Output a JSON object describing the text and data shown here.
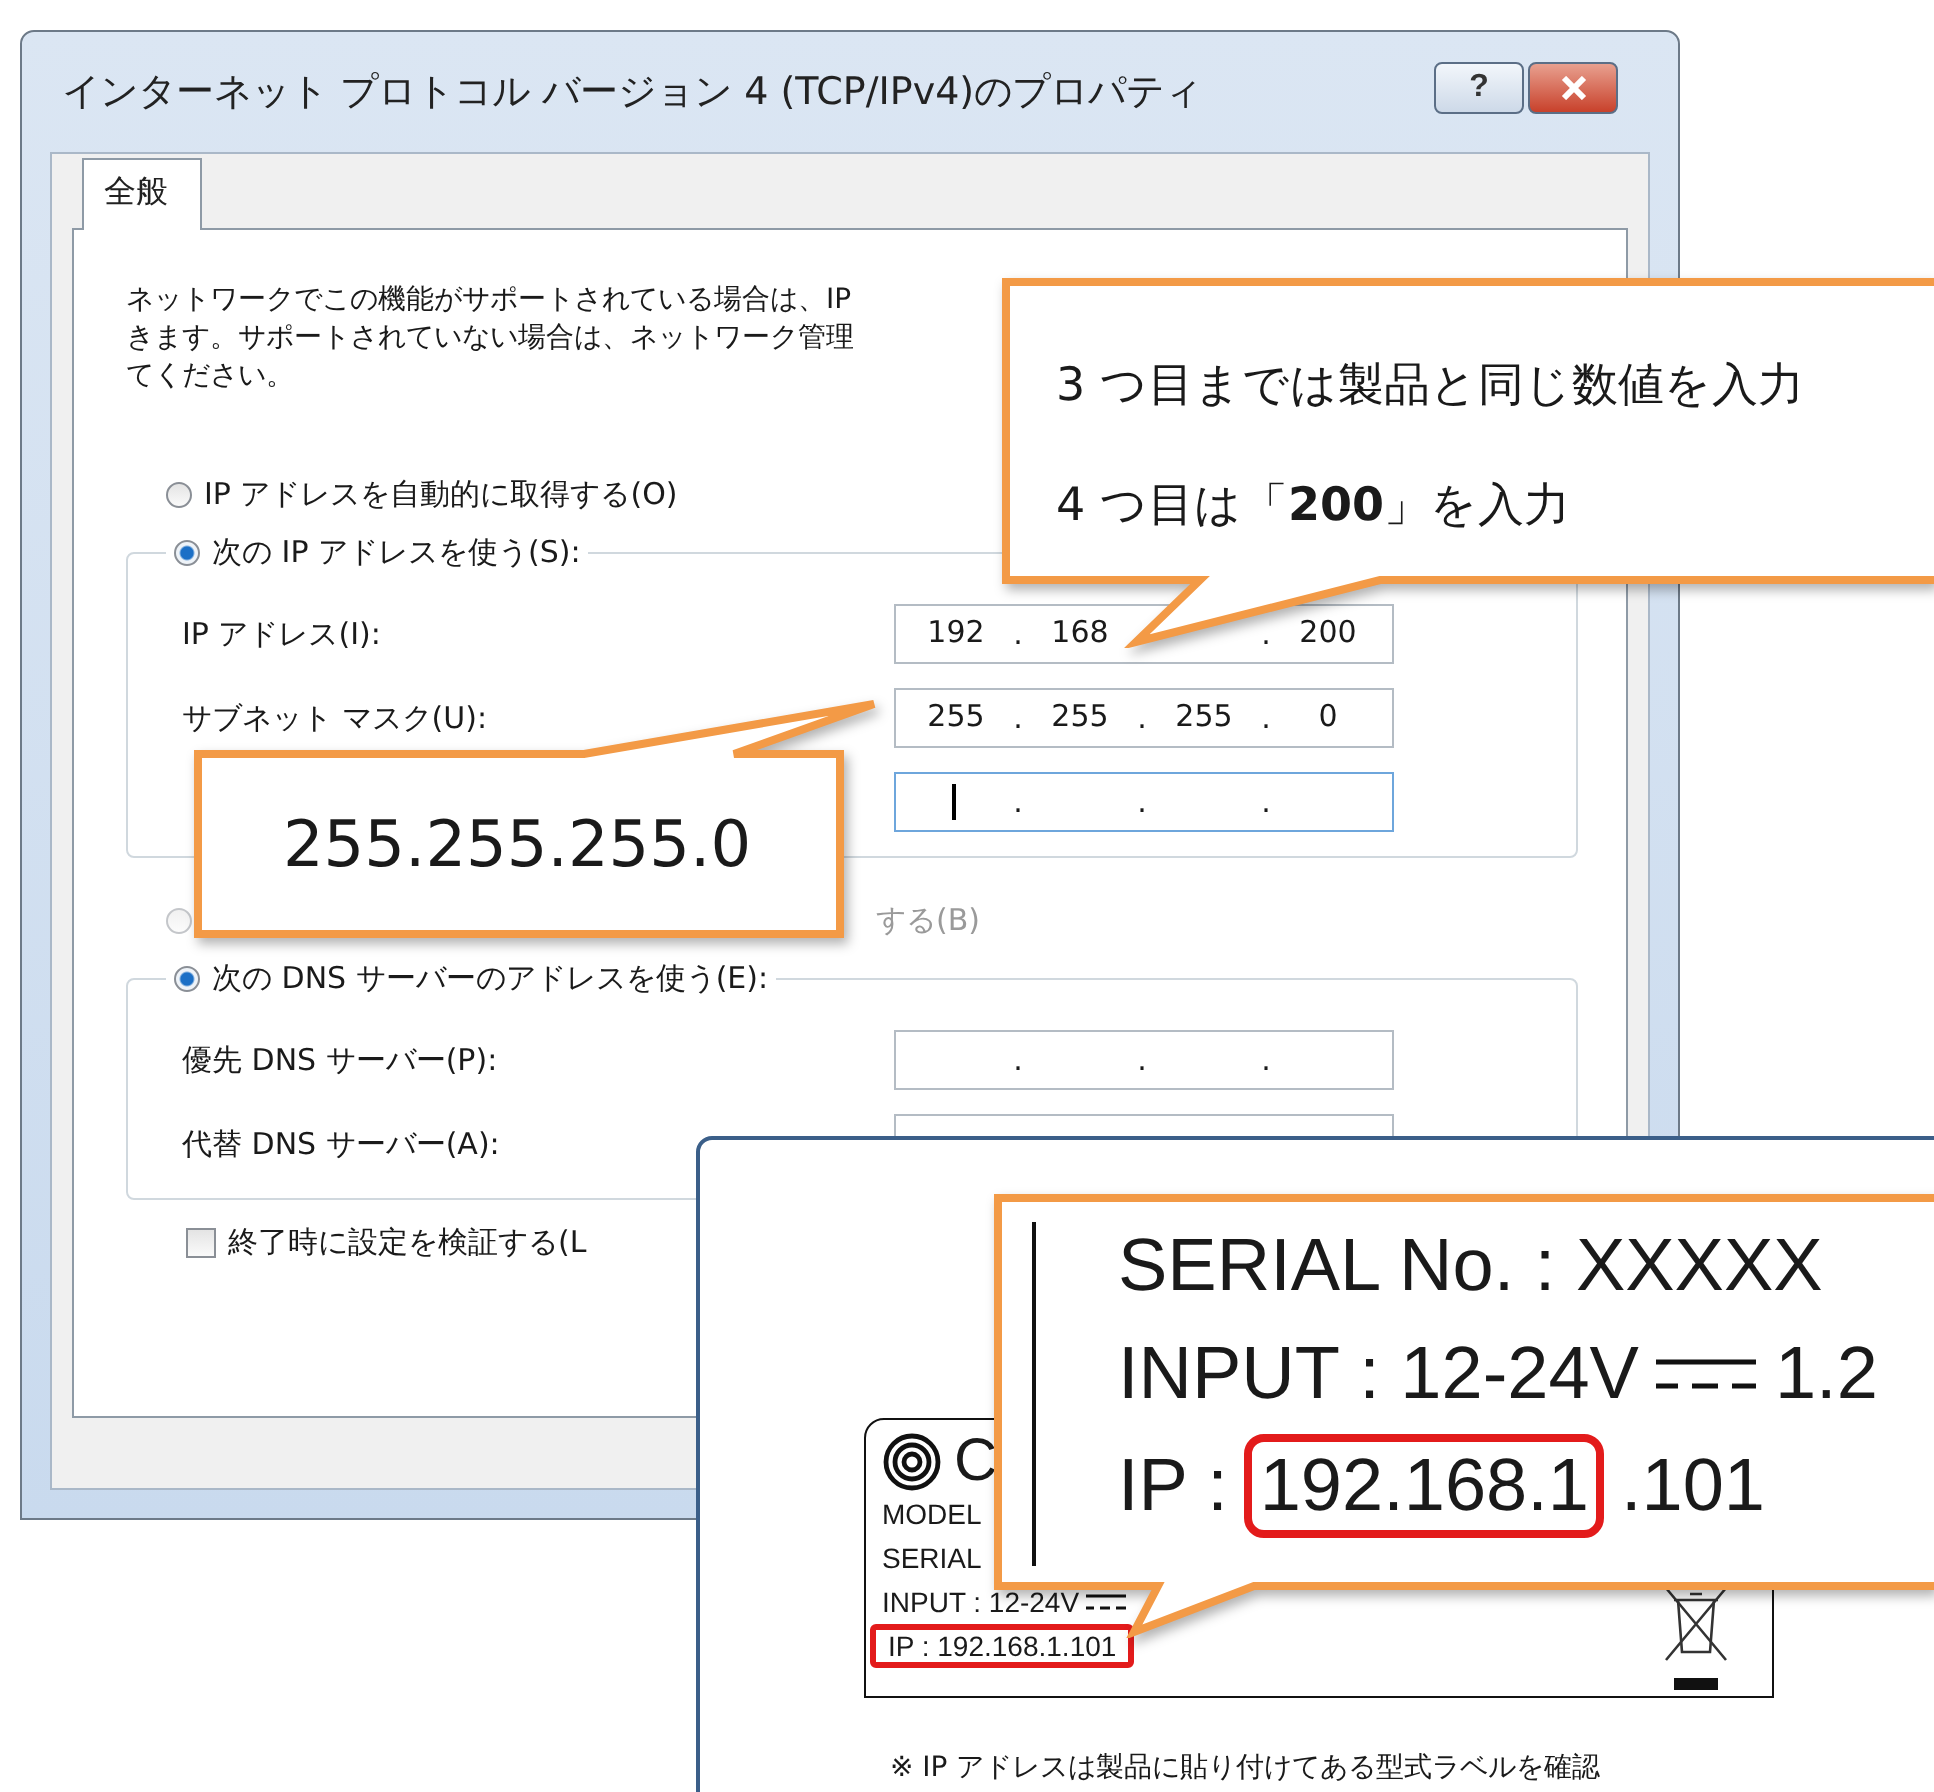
{
  "window": {
    "title": "インターネット プロトコル バージョン 4 (TCP/IPv4)のプロパティ",
    "help_button": "?"
  },
  "tabs": [
    {
      "label": "全般",
      "selected": true
    }
  ],
  "description": [
    "ネットワークでこの機能がサポートされている場合は、IP",
    "きます。サポートされていない場合は、ネットワーク管理",
    "てください。"
  ],
  "ip_mode": [
    {
      "label": "IP アドレスを自動的に取得する(O)",
      "selected": false
    },
    {
      "label": "次の IP アドレスを使う(S):",
      "selected": true
    }
  ],
  "octet_separator": ".",
  "ip_fields": [
    {
      "label": "IP アドレス(I):",
      "octets_before": [
        "192",
        "168"
      ],
      "octets_after": [
        "200"
      ],
      "focused": false
    },
    {
      "label": "サブネット マスク(U):",
      "octets": [
        "255",
        "255",
        "255",
        "0"
      ],
      "focused": false
    },
    {
      "focused": true
    }
  ],
  "dns_mode": [
    {
      "label": "する(B)",
      "selected": false,
      "disabled": true
    },
    {
      "label": "次の DNS サーバーのアドレスを使う(E):",
      "selected": true,
      "disabled": false
    }
  ],
  "dns_fields": [
    {
      "label": "優先 DNS サーバー(P):"
    },
    {
      "label": "代替 DNS サーバー(A):"
    }
  ],
  "validate_checkbox": {
    "label": "終了時に設定を検証する(L",
    "checked": false
  },
  "callouts": [
    {
      "lines": [
        "3 つ目までは製品と同じ数値を入力",
        "4 つ目は「**200**」を入力"
      ]
    },
    {
      "lines": [
        "255.255.255.0"
      ]
    }
  ],
  "product_label": {
    "brand": "C",
    "lines": [
      "MODEL",
      "SERIAL",
      "INPUT : 12-24V"
    ],
    "ip": "IP : 192.168.1.101",
    "caption": "※ IP アドレスは製品に貼り付けてある型式ラベルを確認"
  },
  "label_zoom": {
    "serial": "SERIAL No. :  XXXXX",
    "input": "INPUT : 12-24V",
    "current": "1.2",
    "ip_prefix": "IP :",
    "ip_highlight": "192.168.1",
    "ip_rest": ".101"
  }
}
